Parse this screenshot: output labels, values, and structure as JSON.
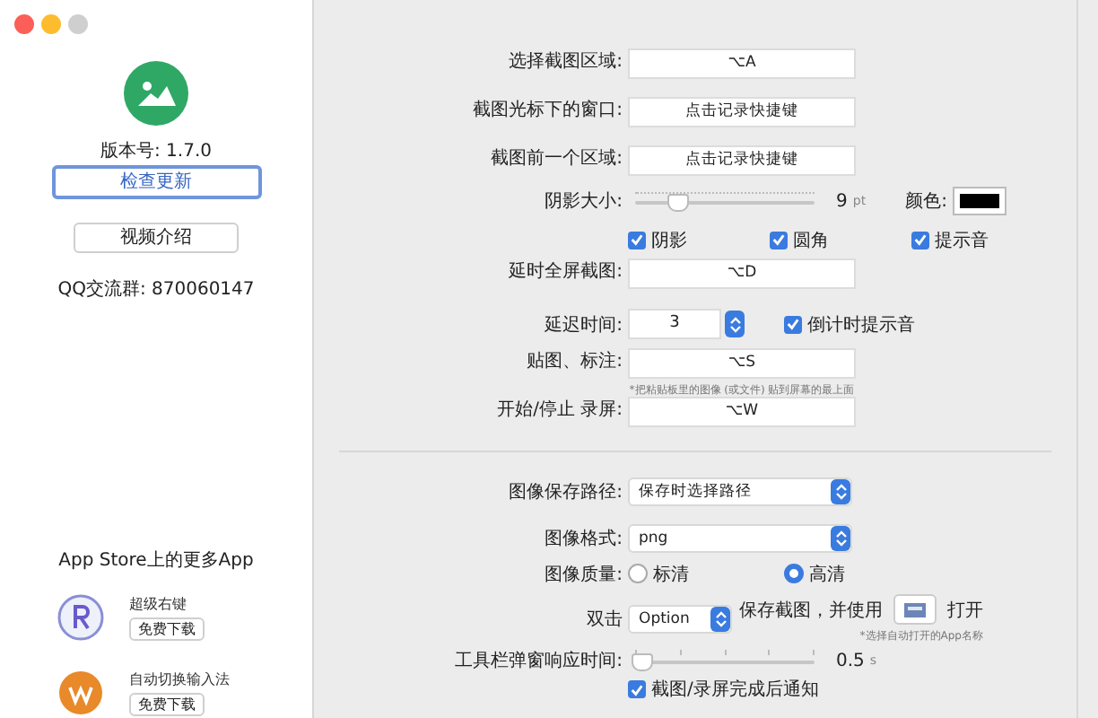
{
  "sidebar": {
    "version": "版本号: 1.7.0",
    "check_update_button": "检查更新",
    "video_button": "视频介绍",
    "qq_group": "QQ交流群:  870060147",
    "more_apps_title": "App Store上的更多App",
    "apps": [
      {
        "kind": "r",
        "name": "超级右键",
        "button": "免费下载"
      },
      {
        "kind": "w",
        "name": "自动切换输入法",
        "button": "免费下载"
      }
    ]
  },
  "settings": [
    {
      "kind": "shortcut",
      "label": "选择截图区域:",
      "value": "⌥A"
    },
    {
      "kind": "shortcut",
      "label": "截图光标下的窗口:",
      "value": "点击记录快捷键"
    },
    {
      "kind": "shortcut",
      "label": "截图前一个区域:",
      "value": "点击记录快捷键"
    },
    {
      "kind": "shadow",
      "label": "阴影大小:",
      "level": 0.2,
      "value": "9",
      "unit": "pt",
      "color_label": "颜色:"
    },
    {
      "kind": "checks",
      "items": [
        {
          "label": "阴影",
          "checked": true
        },
        {
          "label": "圆角",
          "checked": true
        },
        {
          "label": "提示音",
          "checked": true
        }
      ]
    },
    {
      "kind": "shortcut",
      "label": "延时全屏截图:",
      "value": "⌥D"
    },
    {
      "kind": "stepper",
      "label": "延迟时间:",
      "value": "3",
      "checkbox": {
        "label": "倒计时提示音",
        "checked": true
      }
    },
    {
      "kind": "shortcut",
      "label": "贴图、标注:",
      "value": "⌥S",
      "note": "*把粘贴板里的图像 (或文件) 贴到屏幕的最上面"
    },
    {
      "kind": "shortcut",
      "label": "开始/停止 录屏:",
      "value": "⌥W"
    },
    {
      "kind": "divider"
    },
    {
      "kind": "popup",
      "label": "图像保存路径:",
      "value": "保存时选择路径"
    },
    {
      "kind": "popup",
      "label": "图像格式:",
      "value": "png"
    },
    {
      "kind": "radio",
      "label": "图像质量:",
      "options": [
        {
          "label": "标清",
          "selected": false
        },
        {
          "label": "高清",
          "selected": true
        }
      ]
    },
    {
      "kind": "doubleclick",
      "label": "双击",
      "value": "Option",
      "text": "保存截图，并使用",
      "open_label": "打开",
      "note": "*选择自动打开的App名称"
    },
    {
      "kind": "toolbar_slider",
      "label": "工具栏弹窗响应时间:",
      "level": 0,
      "value": "0.5",
      "unit": "s"
    },
    {
      "kind": "check_row",
      "checkbox": {
        "label": "截图/录屏完成后通知",
        "checked": true
      }
    }
  ]
}
